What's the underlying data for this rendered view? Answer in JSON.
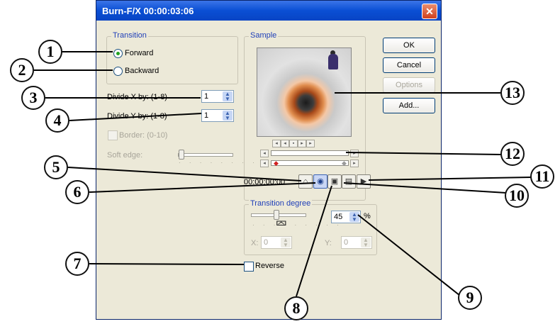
{
  "window": {
    "title": "Burn-F/X  00:00:03:06",
    "close_glyph": "✕"
  },
  "transition": {
    "group_label": "Transition",
    "forward_label": "Forward",
    "backward_label": "Backward",
    "selected": "Forward"
  },
  "divide": {
    "x_label": "Divide X by: (1-8)",
    "x_value": "1",
    "y_label": "Divide Y by: (1-8)",
    "y_value": "1"
  },
  "border": {
    "label": "Border: (0-10)"
  },
  "soft_edge": {
    "label": "Soft edge:"
  },
  "sample": {
    "group_label": "Sample",
    "timecode": "00:00:00:00"
  },
  "buttons": {
    "ok": "OK",
    "cancel": "Cancel",
    "options": "Options",
    "add": "Add..."
  },
  "transition_degree": {
    "group_label": "Transition degree",
    "value": "45",
    "unit": "%",
    "x_label": "X:",
    "x_value": "0",
    "y_label": "Y:",
    "y_value": "0"
  },
  "reverse": {
    "label": "Reverse",
    "checked": false
  },
  "callouts": [
    "1",
    "2",
    "3",
    "4",
    "5",
    "6",
    "7",
    "8",
    "9",
    "10",
    "11",
    "12",
    "13"
  ],
  "icons": {
    "spin": "spin-arrows-icon",
    "play": "play-icon",
    "eye": "eye-icon",
    "cursor": "mouse-cursor-icon"
  },
  "colors": {
    "title_bar": "#0a4fd4",
    "group_label": "#1f3fb8",
    "dialog_bg": "#ece9d8"
  }
}
